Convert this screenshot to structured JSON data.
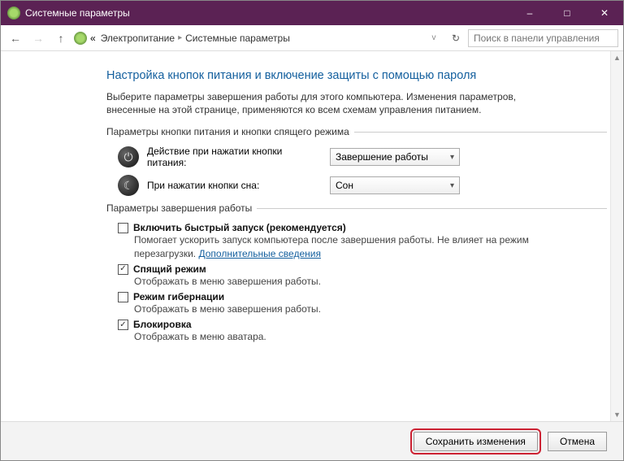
{
  "window": {
    "title": "Системные параметры"
  },
  "nav": {
    "breadcrumb": [
      "Электропитание",
      "Системные параметры"
    ],
    "search_placeholder": "Поиск в панели управления"
  },
  "page": {
    "title": "Настройка кнопок питания и включение защиты с помощью пароля",
    "intro": "Выберите параметры завершения работы для этого компьютера. Изменения параметров, внесенные на этой странице, применяются ко всем схемам управления питанием."
  },
  "section_buttons": {
    "title": "Параметры кнопки питания и кнопки спящего режима",
    "power": {
      "label": "Действие при нажатии кнопки питания:",
      "value": "Завершение работы"
    },
    "sleep": {
      "label": "При нажатии кнопки сна:",
      "value": "Сон"
    }
  },
  "section_shutdown": {
    "title": "Параметры завершения работы",
    "fast_startup": {
      "checked": false,
      "label": "Включить быстрый запуск (рекомендуется)",
      "desc": "Помогает ускорить запуск компьютера после завершения работы. Не влияет на режим перезагрузки.",
      "link": "Дополнительные сведения"
    },
    "sleep_mode": {
      "checked": true,
      "label": "Спящий режим",
      "desc": "Отображать в меню завершения работы."
    },
    "hibernate": {
      "checked": false,
      "label": "Режим гибернации",
      "desc": "Отображать в меню завершения работы."
    },
    "lock": {
      "checked": true,
      "label": "Блокировка",
      "desc": "Отображать в меню аватара."
    }
  },
  "buttons": {
    "save": "Сохранить изменения",
    "cancel": "Отмена"
  }
}
